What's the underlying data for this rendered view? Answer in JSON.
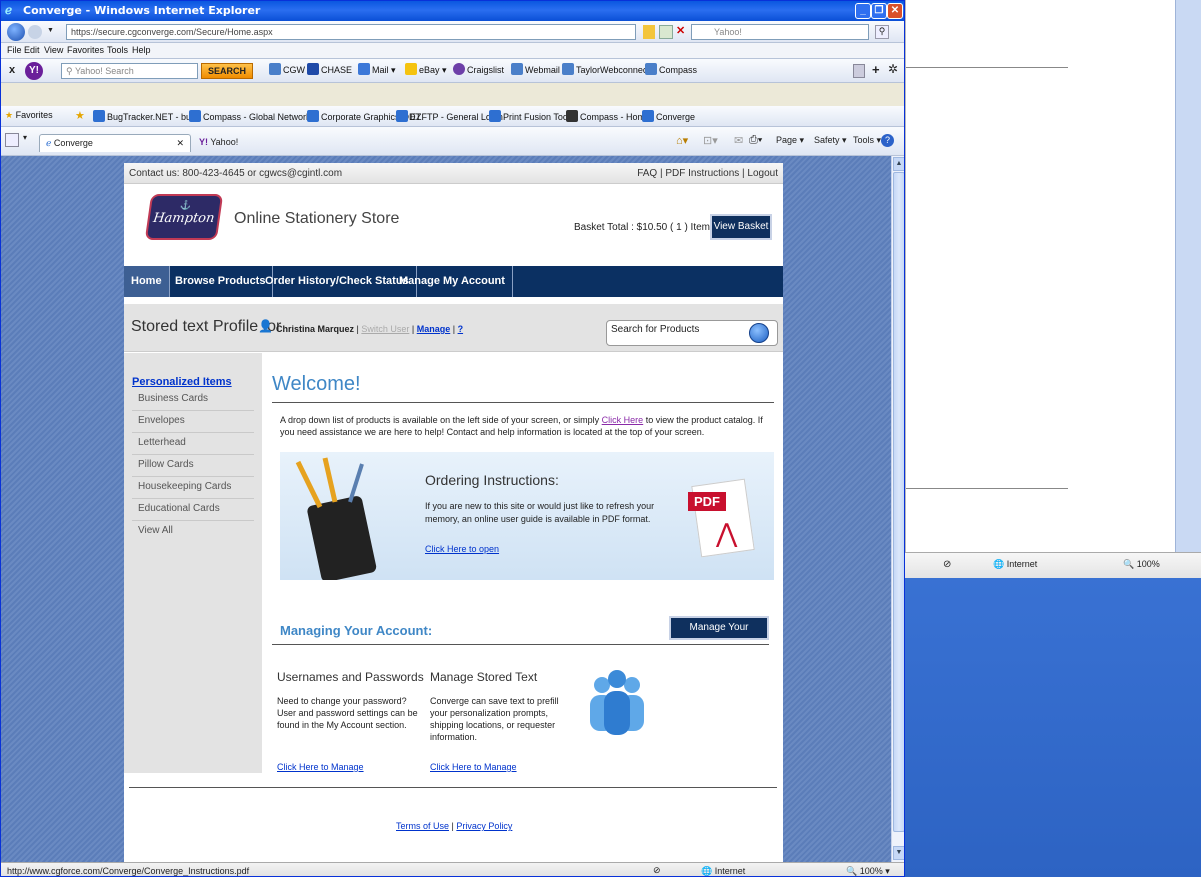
{
  "window": {
    "title": "Converge - Windows Internet Explorer"
  },
  "address_bar": {
    "url": "https://secure.cgconverge.com/Secure/Home.aspx",
    "search_placeholder": "Yahoo!"
  },
  "menu": [
    "File",
    "Edit",
    "View",
    "Favorites",
    "Tools",
    "Help"
  ],
  "yahoo_toolbar": {
    "search_placeholder": "Yahoo! Search",
    "search_button": "SEARCH",
    "items": [
      "CGW",
      "CHASE",
      "Mail",
      "eBay",
      "Craigslist",
      "Webmail",
      "TaylorWebconnect",
      "Compass"
    ]
  },
  "favorites_bar": {
    "label": "Favorites",
    "items": [
      "BugTracker.NET - bugs",
      "Compass - Global Network",
      "Corporate Graphics ODT",
      "EZFTP - General Login",
      "Print Fusion Tool",
      "Compass - Home",
      "Converge"
    ]
  },
  "tabs": [
    {
      "label": "Converge"
    },
    {
      "label": "Yahoo!"
    }
  ],
  "command_bar": {
    "page": "Page",
    "safety": "Safety",
    "tools": "Tools"
  },
  "site": {
    "contact": "Contact us: 800-423-4645 or cgwcs@cgintl.com",
    "top_links": "FAQ | PDF Instructions | Logout",
    "logo_text": "Hampton",
    "store_name": "Online Stationery Store",
    "basket_text": "Basket Total : $10.50  ( 1 ) Items",
    "view_basket": "View Basket",
    "nav": [
      "Home",
      "Browse Products",
      "Order History/Check Status",
      "Manage My Account"
    ],
    "profile_title": "Stored text Profile for",
    "profile_user": "Christina Marquez",
    "switch_user": "Switch User",
    "manage": "Manage",
    "help": "?",
    "search_placeholder": "Search for Products",
    "left_head": "Personalized Items",
    "left_items": [
      "Business Cards",
      "Envelopes",
      "Letterhead",
      "Pillow Cards",
      "Housekeeping Cards",
      "Educational Cards",
      "View All"
    ],
    "welcome": "Welcome!",
    "intro_pre": "A drop down list of products is available on the left side of your screen, or simply ",
    "intro_link": "Click Here",
    "intro_post": " to view the product catalog. If you need assistance we are here to help! Contact and help information is located at the top of your screen.",
    "ordering_title": "Ordering Instructions:",
    "ordering_text": "If you are new to this site or would just like to refresh your memory, an online user guide is available in PDF format.",
    "ordering_link": "Click Here to open",
    "pdf_label": "PDF",
    "managing_title": "Managing Your Account:",
    "manage_button": "Manage Your Account",
    "col1_title": "Usernames and Passwords",
    "col1_text": "Need to change your password? User and password settings can be found in the My Account section.",
    "col1_link": "Click Here to Manage",
    "col2_title": "Manage Stored Text",
    "col2_text": "Converge can save text to prefill your personalization prompts, shipping locations, or requester information.",
    "col2_link": "Click Here to Manage",
    "terms": "Terms of Use",
    "privacy": "Privacy Policy"
  },
  "status": {
    "url": "http://www.cgforce.com/Converge/Converge_Instructions.pdf",
    "zone": "Internet",
    "zoom": "100%"
  },
  "colors": {
    "nav_bg": "#0b3062",
    "accent": "#3f87c6",
    "link": "#0033cc"
  }
}
